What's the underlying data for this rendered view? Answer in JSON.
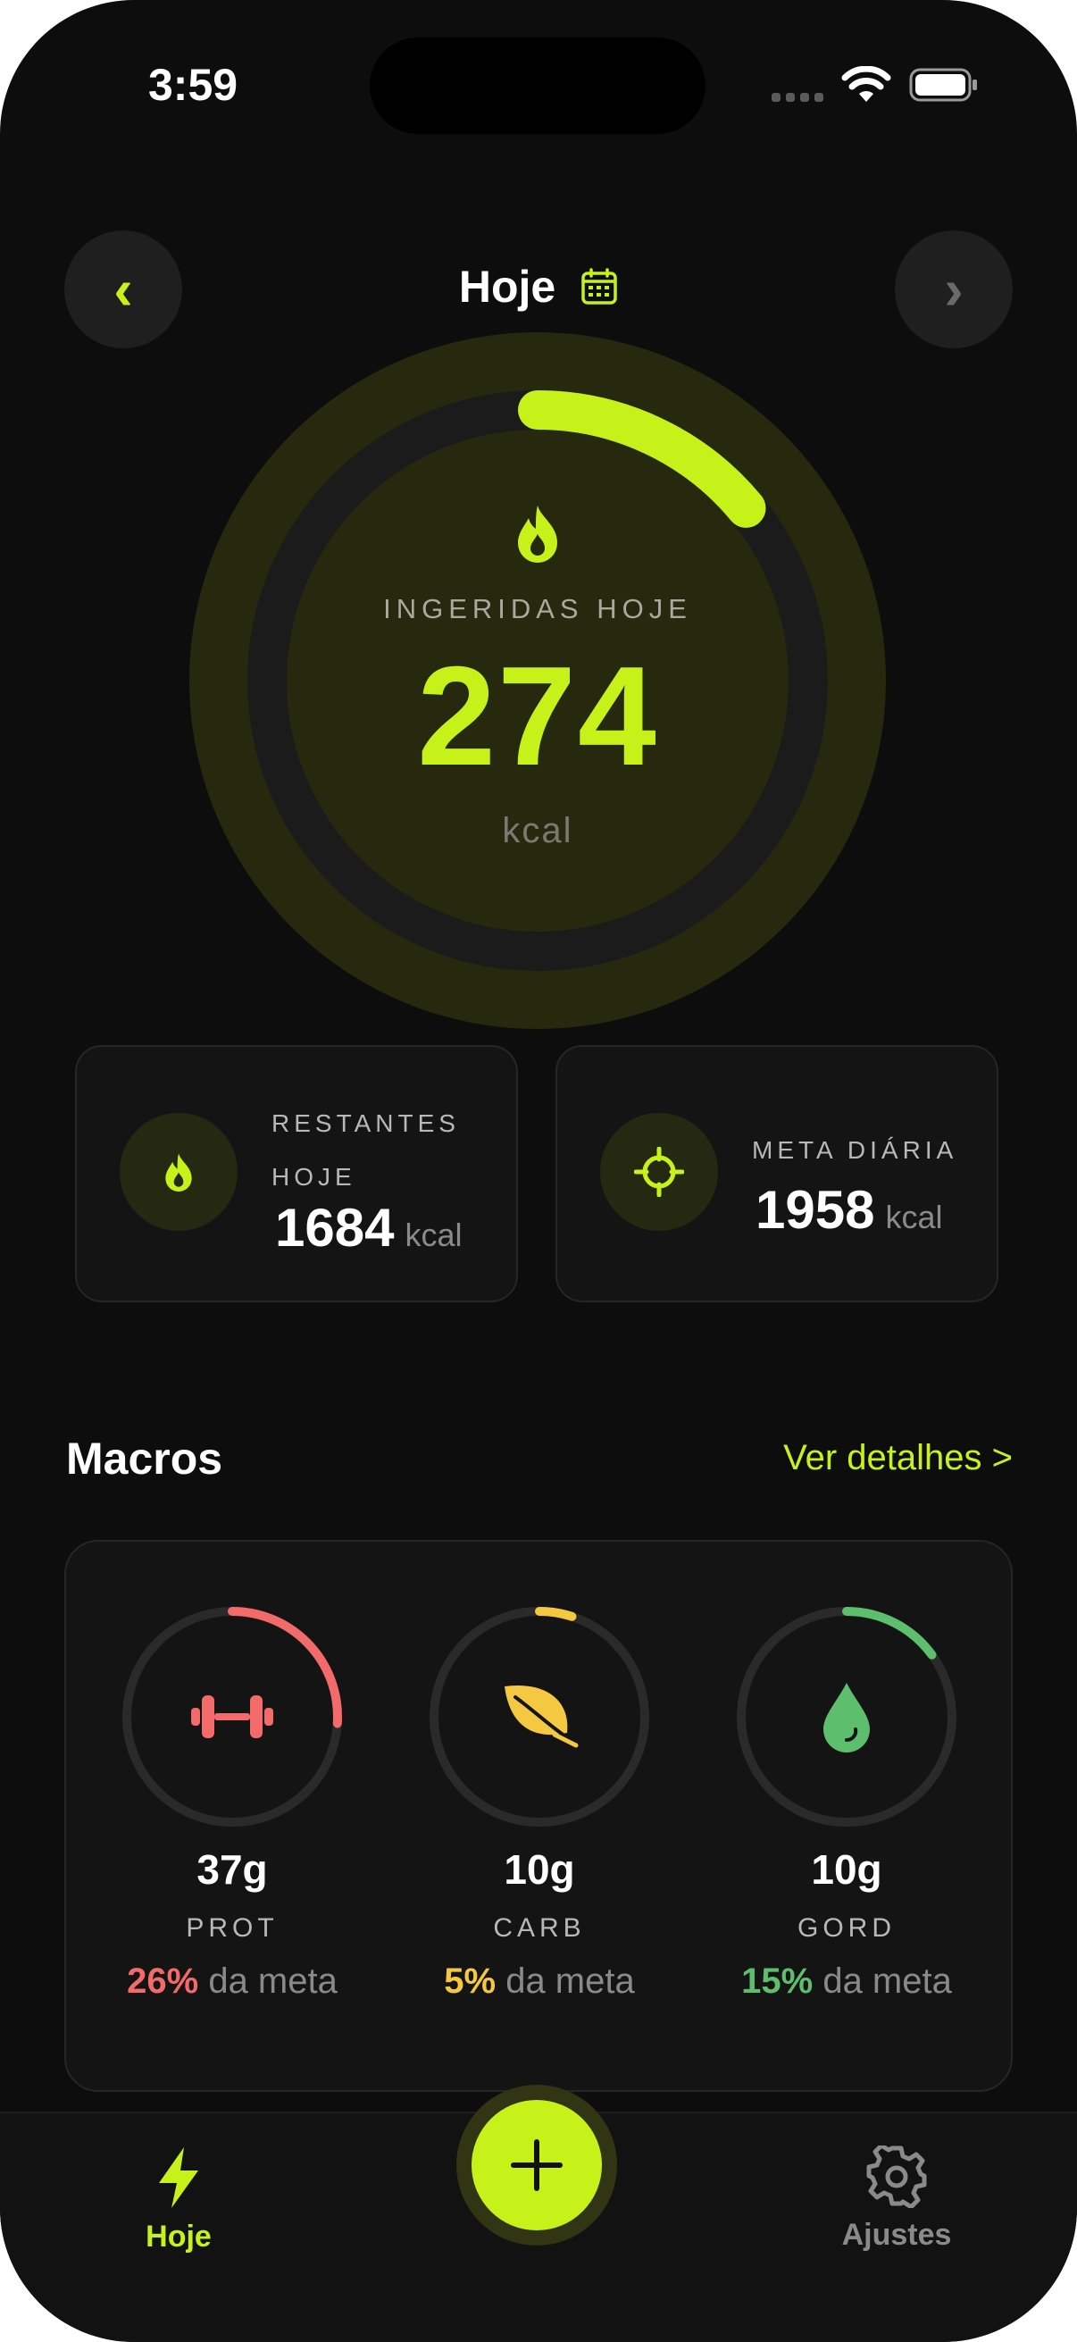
{
  "status_bar": {
    "time": "3:59"
  },
  "header": {
    "title": "Hoje",
    "prev_symbol": "‹",
    "next_symbol": "›"
  },
  "calories": {
    "label": "INGERIDAS HOJE",
    "value": "274",
    "unit": "kcal",
    "progress_fraction": 0.14
  },
  "cards": {
    "remaining": {
      "label": "RESTANTES HOJE",
      "value": "1684",
      "unit": "kcal"
    },
    "goal": {
      "label": "META DIÁRIA",
      "value": "1958",
      "unit": "kcal"
    }
  },
  "macros": {
    "title": "Macros",
    "link": "Ver detalhes >",
    "items": [
      {
        "grams": "37g",
        "name": "PROT",
        "pct": "26%",
        "suffix": "da meta",
        "color": "#f26a6a",
        "fraction": 0.26,
        "icon": "dumbbell-icon"
      },
      {
        "grams": "10g",
        "name": "CARB",
        "pct": "5%",
        "suffix": "da meta",
        "color": "#f5c842",
        "fraction": 0.05,
        "icon": "leaf-icon"
      },
      {
        "grams": "10g",
        "name": "GORD",
        "pct": "15%",
        "suffix": "da meta",
        "color": "#5dbf6e",
        "fraction": 0.15,
        "icon": "drop-icon"
      }
    ]
  },
  "tabbar": {
    "home": {
      "label": "Hoje",
      "icon": "bolt-icon"
    },
    "add": {
      "icon": "plus-icon"
    },
    "settings": {
      "label": "Ajustes",
      "icon": "gear-icon"
    }
  },
  "colors": {
    "accent": "#c6f21a",
    "background": "#0d0d0d",
    "card": "#141414"
  }
}
